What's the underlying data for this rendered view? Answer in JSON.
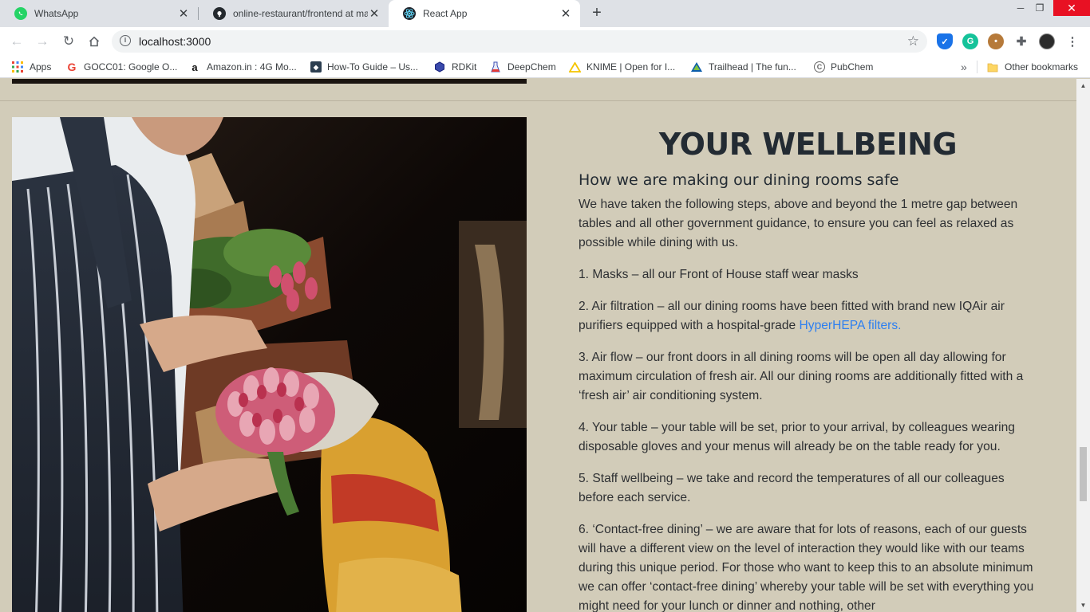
{
  "browser": {
    "tabs": [
      {
        "title": "WhatsApp",
        "icon": "whatsapp-icon"
      },
      {
        "title": "online-restaurant/frontend at ma",
        "icon": "github-icon"
      },
      {
        "title": "React App",
        "icon": "react-icon",
        "active": true
      }
    ],
    "new_tab": "+",
    "url": "localhost:3000",
    "bookmarks": [
      {
        "label": "Apps",
        "icon": "apps-grid-icon"
      },
      {
        "label": "GOCC01: Google O...",
        "icon": "google-icon"
      },
      {
        "label": "Amazon.in : 4G Mo...",
        "icon": "amazon-icon"
      },
      {
        "label": "How-To Guide – Us...",
        "icon": "shield-bookmark-icon"
      },
      {
        "label": "RDKit",
        "icon": "rdkit-icon"
      },
      {
        "label": "DeepChem",
        "icon": "flask-icon"
      },
      {
        "label": "KNIME | Open for I...",
        "icon": "knime-icon"
      },
      {
        "label": "Trailhead | The fun...",
        "icon": "trailhead-icon"
      },
      {
        "label": "PubChem",
        "icon": "pubchem-icon"
      }
    ],
    "bookmarks_overflow": "»",
    "other_bookmarks": "Other bookmarks"
  },
  "page": {
    "heading": "YOUR WELLBEING",
    "subheading": "How we are making our dining rooms safe",
    "intro": "We have taken the following steps, above and beyond the 1 metre gap between tables and all other government guidance, to ensure you can feel as relaxed as possible while dining with us.",
    "items": [
      {
        "text": "1. Masks – all our Front of House staff wear masks"
      },
      {
        "text": "2. Air filtration – all our dining rooms have been fitted with brand new IQAir air purifiers equipped with a hospital-grade ",
        "link": "HyperHEPA filters."
      },
      {
        "text": "3. Air flow – our front doors in all dining rooms will be open all day allowing for maximum circulation of fresh air. All our dining rooms are additionally fitted with a ‘fresh air’ air conditioning system."
      },
      {
        "text": "4. Your table – your table will be set, prior to your arrival, by colleagues wearing disposable gloves and your menus will already be on the table ready for you."
      },
      {
        "text": "5. Staff wellbeing – we take and record the temperatures of all our colleagues before each service."
      },
      {
        "text": "6. ‘Contact-free dining’ – we are aware that for lots of reasons, each of our guests will have a different view on the level of interaction they would like with our teams during this unique period. For those who want to keep this to an absolute minimum we can offer ‘contact-free dining’ whereby your table will be set with everything you might need for your lunch or dinner and nothing, other"
      }
    ],
    "colors": {
      "background": "#d2ccb9",
      "heading": "#232b33",
      "link": "#2d7ff0"
    }
  }
}
